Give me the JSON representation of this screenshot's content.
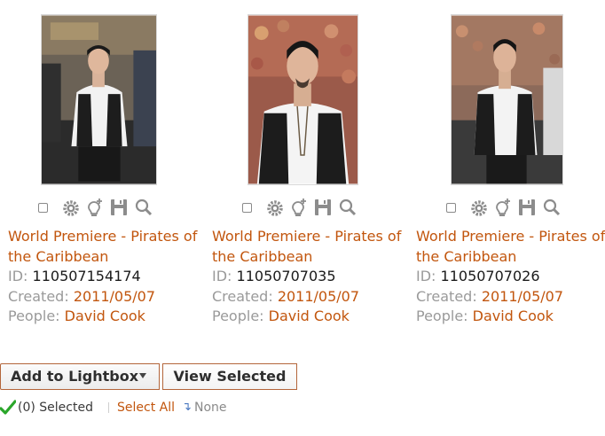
{
  "results": [
    {
      "title": "World Premiere - Pirates of the Caribbean",
      "id_label": "ID:",
      "id": "110507154174",
      "created_label": "Created:",
      "created": "2011/05/07",
      "people_label": "People:",
      "people": "David Cook"
    },
    {
      "title": "World Premiere - Pirates of the Caribbean",
      "id_label": "ID:",
      "id": "11050707035",
      "created_label": "Created:",
      "created": "2011/05/07",
      "people_label": "People:",
      "people": "David Cook"
    },
    {
      "title": "World Premiere - Pirates of the Caribbean",
      "id_label": "ID:",
      "id": "11050707026",
      "created_label": "Created:",
      "created": "2011/05/07",
      "people_label": "People:",
      "people": "David Cook"
    }
  ],
  "toolbar": {
    "add_to_lightbox": "Add to Lightbox",
    "view_selected": "View Selected"
  },
  "selection": {
    "count_text": "(0) Selected",
    "select_all": "Select All",
    "none": "None"
  },
  "colors": {
    "link": "#c2560e",
    "label": "#9a9a9a",
    "button_border": "#b3653a",
    "check": "#2aa62a"
  },
  "icons": [
    "checkbox",
    "gear-icon",
    "lightbulb-plus-icon",
    "save-icon",
    "zoom-icon"
  ]
}
